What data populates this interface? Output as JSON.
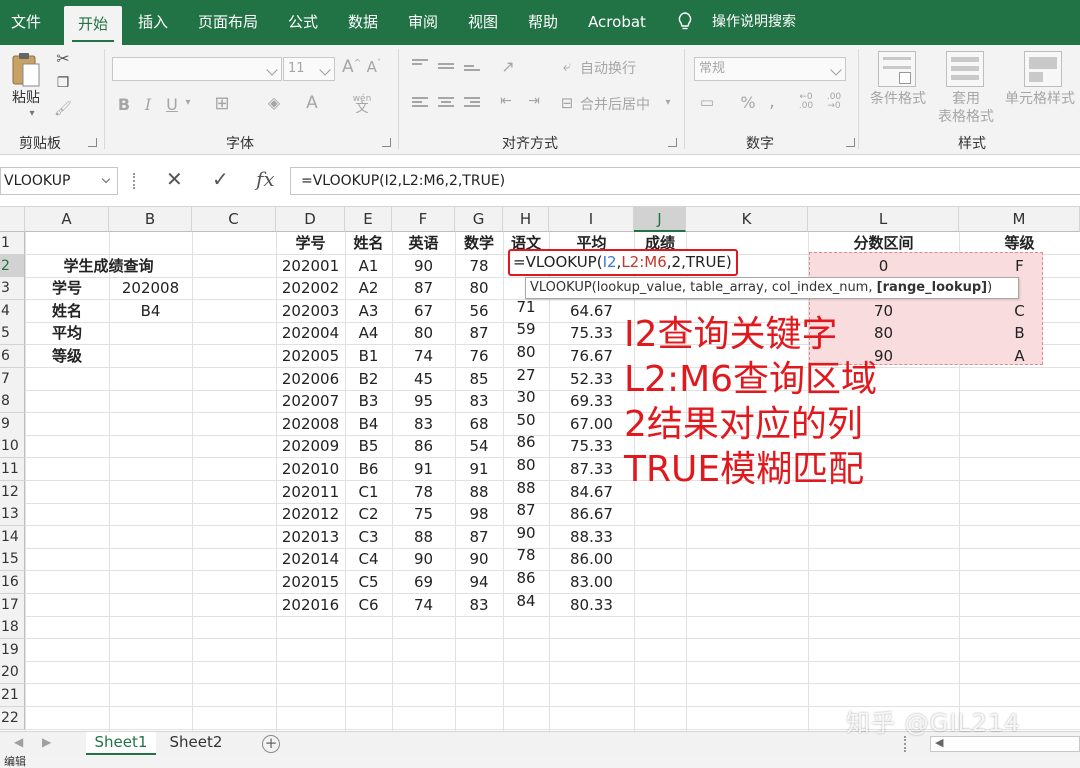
{
  "ribbon_tabs": [
    {
      "label": "文件"
    },
    {
      "label": "开始"
    },
    {
      "label": "插入"
    },
    {
      "label": "页面布局"
    },
    {
      "label": "公式"
    },
    {
      "label": "数据"
    },
    {
      "label": "审阅"
    },
    {
      "label": "视图"
    },
    {
      "label": "帮助"
    },
    {
      "label": "Acrobat"
    },
    {
      "label": "操作说明搜索"
    }
  ],
  "active_tab": "开始",
  "ribbon": {
    "clipboard": {
      "paste": "粘贴",
      "label": "剪贴板"
    },
    "font": {
      "size": "11",
      "bold": "B",
      "italic": "I",
      "underline": "U",
      "label": "字体",
      "wen": "wén",
      "wen2": "文"
    },
    "alignment": {
      "wrap": "自动换行",
      "merge": "合并后居中",
      "label": "对齐方式"
    },
    "number": {
      "format": "常规",
      "label": "数字",
      "percent": "%",
      "comma": ","
    },
    "styles": {
      "conditional": "条件格式",
      "table1": "套用",
      "table2": "表格格式",
      "cell": "单元格样式",
      "label": "样式"
    }
  },
  "formula_bar": {
    "name_box": "VLOOKUP",
    "cancel": "✕",
    "enter": "✓",
    "fx": "fx",
    "formula": "=VLOOKUP(I2,L2:M6,2,TRUE)"
  },
  "columns": [
    "A",
    "B",
    "C",
    "D",
    "E",
    "F",
    "G",
    "H",
    "I",
    "J",
    "K",
    "L",
    "M"
  ],
  "rows": [
    "1",
    "2",
    "3",
    "4",
    "5",
    "6",
    "7",
    "8",
    "9",
    "10",
    "11",
    "12",
    "13",
    "14",
    "15",
    "16",
    "17",
    "18",
    "19",
    "20",
    "21",
    "22"
  ],
  "lookup_panel": {
    "title": "学生成绩查询",
    "id_label": "学号",
    "id_value": "202008",
    "name_label": "姓名",
    "name_value": "B4",
    "avg_label": "平均",
    "grade_label": "等级"
  },
  "table_headers": [
    "学号",
    "姓名",
    "英语",
    "数学",
    "语文",
    "平均",
    "成绩"
  ],
  "students": [
    {
      "id": "202001",
      "name": "A1",
      "en": "90",
      "math": "78",
      "cn": "",
      "avg": ""
    },
    {
      "id": "202002",
      "name": "A2",
      "en": "87",
      "math": "80",
      "cn": "",
      "avg": ""
    },
    {
      "id": "202003",
      "name": "A3",
      "en": "67",
      "math": "56",
      "cn": "71",
      "avg": "64.67"
    },
    {
      "id": "202004",
      "name": "A4",
      "en": "80",
      "math": "87",
      "cn": "59",
      "avg": "75.33"
    },
    {
      "id": "202005",
      "name": "B1",
      "en": "74",
      "math": "76",
      "cn": "80",
      "avg": "76.67"
    },
    {
      "id": "202006",
      "name": "B2",
      "en": "45",
      "math": "85",
      "cn": "27",
      "avg": "52.33"
    },
    {
      "id": "202007",
      "name": "B3",
      "en": "95",
      "math": "83",
      "cn": "30",
      "avg": "69.33"
    },
    {
      "id": "202008",
      "name": "B4",
      "en": "83",
      "math": "68",
      "cn": "50",
      "avg": "67.00"
    },
    {
      "id": "202009",
      "name": "B5",
      "en": "86",
      "math": "54",
      "cn": "86",
      "avg": "75.33"
    },
    {
      "id": "202010",
      "name": "B6",
      "en": "91",
      "math": "91",
      "cn": "80",
      "avg": "87.33"
    },
    {
      "id": "202011",
      "name": "C1",
      "en": "78",
      "math": "88",
      "cn": "88",
      "avg": "84.67"
    },
    {
      "id": "202012",
      "name": "C2",
      "en": "75",
      "math": "98",
      "cn": "87",
      "avg": "86.67"
    },
    {
      "id": "202013",
      "name": "C3",
      "en": "88",
      "math": "87",
      "cn": "90",
      "avg": "88.33"
    },
    {
      "id": "202014",
      "name": "C4",
      "en": "90",
      "math": "90",
      "cn": "78",
      "avg": "86.00"
    },
    {
      "id": "202015",
      "name": "C5",
      "en": "69",
      "math": "94",
      "cn": "86",
      "avg": "83.00"
    },
    {
      "id": "202016",
      "name": "C6",
      "en": "74",
      "math": "83",
      "cn": "84",
      "avg": "80.33"
    }
  ],
  "grade_table": {
    "header_score": "分数区间",
    "header_grade": "等级",
    "rows": [
      {
        "score": "0",
        "grade": "F"
      },
      {
        "score": "",
        "grade": ""
      },
      {
        "score": "70",
        "grade": "C"
      },
      {
        "score": "80",
        "grade": "B"
      },
      {
        "score": "90",
        "grade": "A"
      }
    ]
  },
  "edit_cell": {
    "prefix": "=VLOOKUP(",
    "arg1": "I2",
    "comma1": ",",
    "arg2": "L2:M6",
    "rest": ",2,TRUE)"
  },
  "tooltip": {
    "text": "VLOOKUP(lookup_value, table_array, col_index_num, ",
    "bold": "[range_lookup]",
    "close": ")"
  },
  "annotations": [
    "I2查询关键字",
    "L2:M6查询区域",
    "2结果对应的列",
    "TRUE模糊匹配"
  ],
  "sheets": [
    {
      "label": "Sheet1"
    },
    {
      "label": "Sheet2"
    }
  ],
  "active_sheet": "Sheet1",
  "watermark": "知乎 @GIL214",
  "status_text": "编辑",
  "colors": {
    "excel_green": "#217346",
    "annotation_red": "#e0191e",
    "highlight_pink": "#f8dcde"
  }
}
